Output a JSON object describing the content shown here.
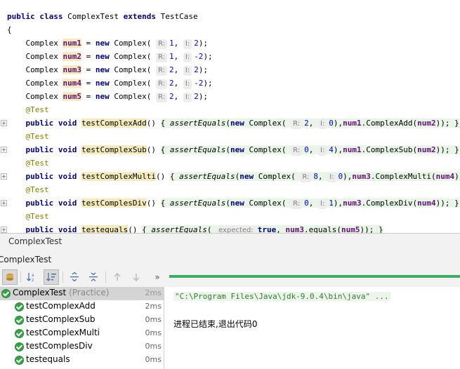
{
  "code": {
    "class_decl": {
      "kw1": "public",
      "kw2": "class",
      "name": "ComplexTest",
      "kw3": "extends",
      "parent": "TestCase"
    },
    "brace": "{",
    "fields": [
      {
        "type": "Complex",
        "name": "num1",
        "r": "1",
        "i": "2"
      },
      {
        "type": "Complex",
        "name": "num2",
        "r": "1",
        "i": "-2"
      },
      {
        "type": "Complex",
        "name": "num3",
        "r": "2",
        "i": "2"
      },
      {
        "type": "Complex",
        "name": "num4",
        "r": "2",
        "i": "-2"
      },
      {
        "type": "Complex",
        "name": "num5",
        "r": "2",
        "i": "2"
      }
    ],
    "kw_new": "new",
    "ctor": "Complex",
    "hint_r": "R:",
    "hint_i": "I:",
    "annotation": "@Test",
    "kw_public": "public",
    "kw_void": "void",
    "assert": "assertEquals",
    "methods": [
      {
        "name": "testComplexAdd",
        "r": "2",
        "i": "0",
        "target": "num1",
        "call": "ComplexAdd",
        "arg": "num2"
      },
      {
        "name": "testComplexSub",
        "r": "0",
        "i": "4",
        "target": "num1",
        "call": "ComplexSub",
        "arg": "num2"
      },
      {
        "name": "testComplexMulti",
        "r": "8",
        "i": "0",
        "target": "num3",
        "call": "ComplexMulti",
        "arg": "num4"
      },
      {
        "name": "testComplesDiv",
        "r": "0",
        "i": "1",
        "target": "num3",
        "call": "ComplexDiv",
        "arg": "num4"
      }
    ],
    "last_method": {
      "name": "testequals",
      "hint": "expected:",
      "value": "true",
      "target": "num3",
      "call": "equals",
      "arg": "num5"
    }
  },
  "toolwindow": {
    "title": "ComplexTest",
    "tab": "ComplexTest"
  },
  "toolbar": {
    "icons": [
      "run-config-icon",
      "sort-alpha-icon",
      "sort-duration-icon",
      "expand-all-icon",
      "collapse-all-icon",
      "prev-failed-icon",
      "next-failed-icon",
      "more-icon"
    ],
    "more": "»"
  },
  "progress": {
    "fraction": 1.0,
    "color": "#3cad61"
  },
  "tree": {
    "root": {
      "label": "ComplexTest",
      "suffix": "(Practice)",
      "time": "2ms"
    },
    "items": [
      {
        "label": "testComplexAdd",
        "time": "2ms"
      },
      {
        "label": "testComplexSub",
        "time": "0ms"
      },
      {
        "label": "testComplexMulti",
        "time": "0ms"
      },
      {
        "label": "testComplesDiv",
        "time": "0ms"
      },
      {
        "label": "testequals",
        "time": "0ms"
      }
    ]
  },
  "console": {
    "line1": "\"C:\\Program Files\\Java\\jdk-9.0.4\\bin\\java\" ...",
    "line2": "进程已结束,退出代码0"
  },
  "colors": {
    "pass": "#3ba04a",
    "keyword": "#000080",
    "field": "#660e7a",
    "annotation": "#808000"
  }
}
